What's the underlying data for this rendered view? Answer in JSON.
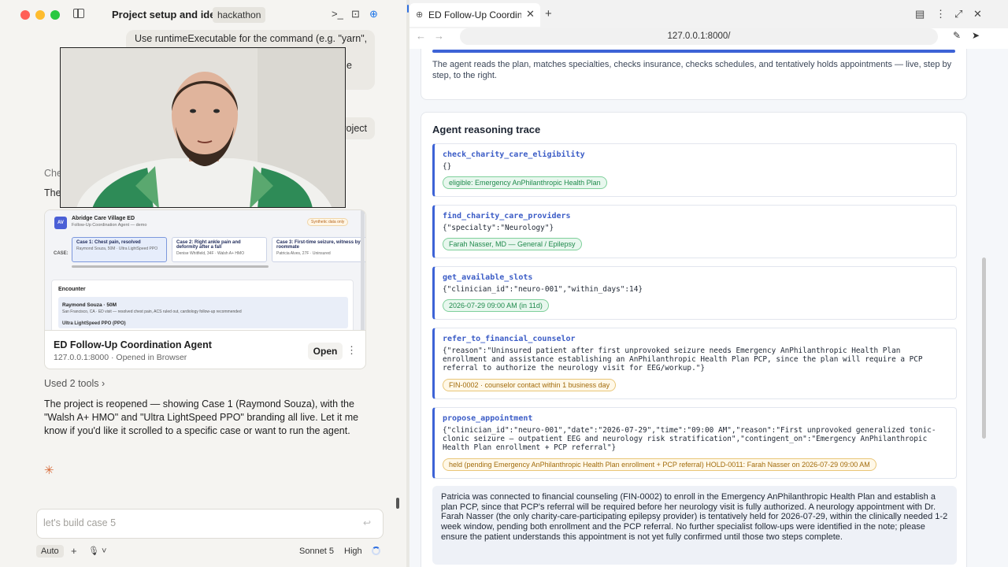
{
  "left": {
    "project_title": "Project setup and ideas",
    "project_badge": "hackathon",
    "chat_bubble_text": "Use runtimeExecutable for the command (e.g. \"yarn\",",
    "chat_bubble_tail": "e",
    "project_pill": "roject",
    "faded_line": "Che",
    "partial_line": "The",
    "card": {
      "preview": {
        "logo": "AV",
        "app_title": "Abridge Care Village ED",
        "app_subtitle": "Follow-Up Coordination Agent — demo",
        "badge": "Synthetic data only",
        "case_label": "CASE:",
        "cases": [
          {
            "title": "Case 1: Chest pain, resolved",
            "subtitle": "Raymond Souza, 50M · Ultra LightSpeed PPO"
          },
          {
            "title": "Case 2: Right ankle pain and deformity after a fall",
            "subtitle": "Denise Whitfield, 34F · Walsh A+ HMO"
          },
          {
            "title": "Case 3: First-time seizure, witness by roommate",
            "subtitle": "Patricia Alves, 27F · Uninsured"
          }
        ],
        "encounter_heading": "Encounter",
        "encounter_name": "Raymond Souza · 50M",
        "encounter_desc": "San Francisco, CA · ED visit — resolved chest pain, ACS ruled out, cardiology follow-up recommended",
        "encounter_plan": "Ultra LightSpeed PPO (PPO)"
      },
      "title": "ED Follow-Up Coordination Agent",
      "subtitle": "127.0.0.1:8000 · Opened in Browser",
      "open_label": "Open",
      "more_icon": "⋮"
    },
    "used_tools": "Used 2 tools ›",
    "message": "The project is reopened — showing Case 1 (Raymond Souza), with the \"Walsh A+ HMO\" and \"Ultra LightSpeed PPO\" branding all live. Let it me know if you'd like it scrolled to a specific case or want to run the agent.",
    "spinner_glyph": "✳",
    "composer_placeholder": "let's build case 5",
    "send_glyph": "↩",
    "mode_label": "Auto",
    "plus_glyph": "+",
    "mic_glyph": "🎙 ˅",
    "model_label": "Sonnet 5",
    "effort_label": "High"
  },
  "browser": {
    "tab_title": "ED Follow-Up Coordinator",
    "tab_close": "✕",
    "new_tab": "+",
    "url": "127.0.0.1:8000/",
    "back_glyph": "←",
    "fwd_glyph": "→"
  },
  "page": {
    "intro_text": "The agent reads the plan, matches specialties, checks insurance, checks schedules, and tentatively holds appointments — live, step by step, to the right.",
    "trace_title": "Agent reasoning trace",
    "steps": [
      {
        "name": "check_charity_care_eligibility",
        "args": "{}",
        "result": "eligible: Emergency AnPhilanthropic Health Plan",
        "status": "green"
      },
      {
        "name": "find_charity_care_providers",
        "args": "{\"specialty\":\"Neurology\"}",
        "result": "Farah Nasser, MD — General / Epilepsy",
        "status": "green"
      },
      {
        "name": "get_available_slots",
        "args": "{\"clinician_id\":\"neuro-001\",\"within_days\":14}",
        "result": "2026-07-29 09:00 AM (in 11d)",
        "status": "green"
      },
      {
        "name": "refer_to_financial_counselor",
        "args": "{\"reason\":\"Uninsured patient after first unprovoked seizure needs Emergency AnPhilanthropic Health Plan enrollment and assistance establishing an AnPhilanthropic Health Plan PCP, since the plan will require a PCP referral to authorize the neurology visit for EEG/workup.\"}",
        "result": "FIN-0002 · counselor contact within 1 business day",
        "status": "amber"
      },
      {
        "name": "propose_appointment",
        "args": "{\"clinician_id\":\"neuro-001\",\"date\":\"2026-07-29\",\"time\":\"09:00 AM\",\"reason\":\"First unprovoked generalized tonic-clonic seizure — outpatient EEG and neurology risk stratification\",\"contingent_on\":\"Emergency AnPhilanthropic Health Plan enrollment + PCP referral\"}",
        "result": "held (pending Emergency AnPhilanthropic Health Plan enrollment + PCP referral) HOLD-0011: Farah Nasser on 2026-07-29 09:00 AM",
        "status": "amber"
      }
    ],
    "summary": "Patricia was connected to financial counseling (FIN-0002) to enroll in the Emergency AnPhilanthropic Health Plan and establish a plan PCP, since that PCP's referral will be required before her neurology visit is fully authorized. A neurology appointment with Dr. Farah Nasser (the only charity-care-participating epilepsy provider) is tentatively held for 2026-07-29, within the clinically needed 1-2 week window, pending both enrollment and the PCP referral. No further specialist follow-ups were identified in the note; please ensure the patient understands this appointment is not yet fully confirmed until those two steps complete."
  },
  "colors": {
    "accent": "#3d63d6",
    "success": "#1f8a4c",
    "warning": "#a26c0c",
    "brand_star": "#d76b3a"
  }
}
